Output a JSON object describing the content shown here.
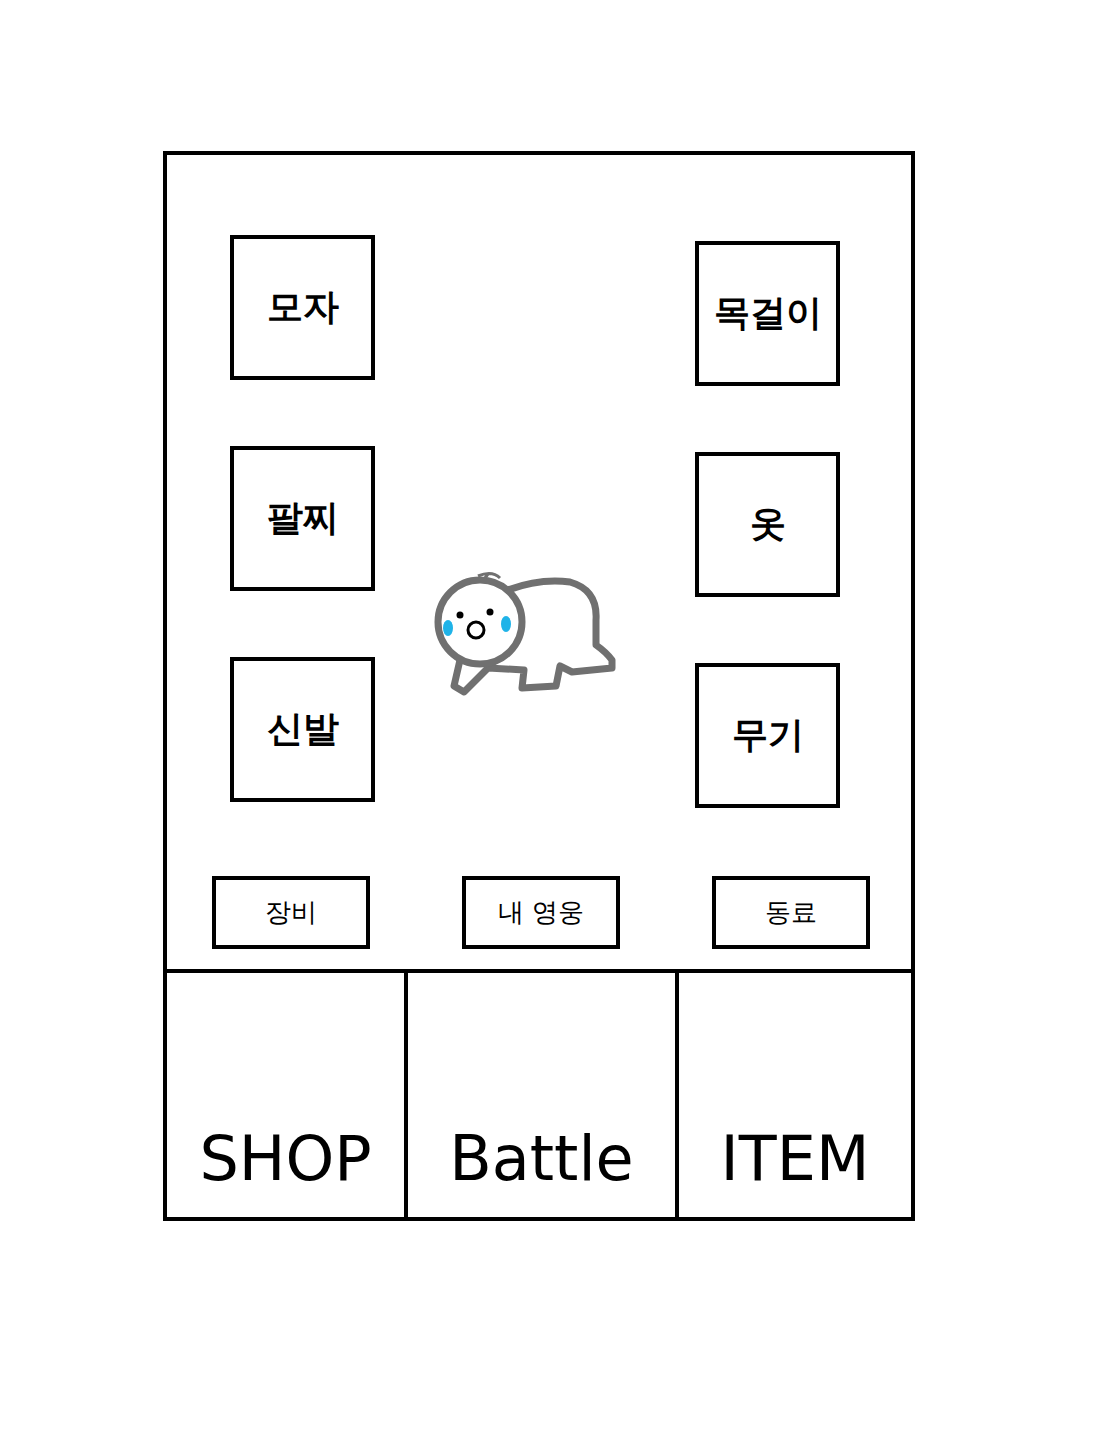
{
  "slots": {
    "left": [
      "모자",
      "팔찌",
      "신발"
    ],
    "right": [
      "목걸이",
      "옷",
      "무기"
    ]
  },
  "tabs": [
    "장비",
    "내 영웅",
    "동료"
  ],
  "nav": [
    "SHOP",
    "Battle",
    "ITEM"
  ]
}
